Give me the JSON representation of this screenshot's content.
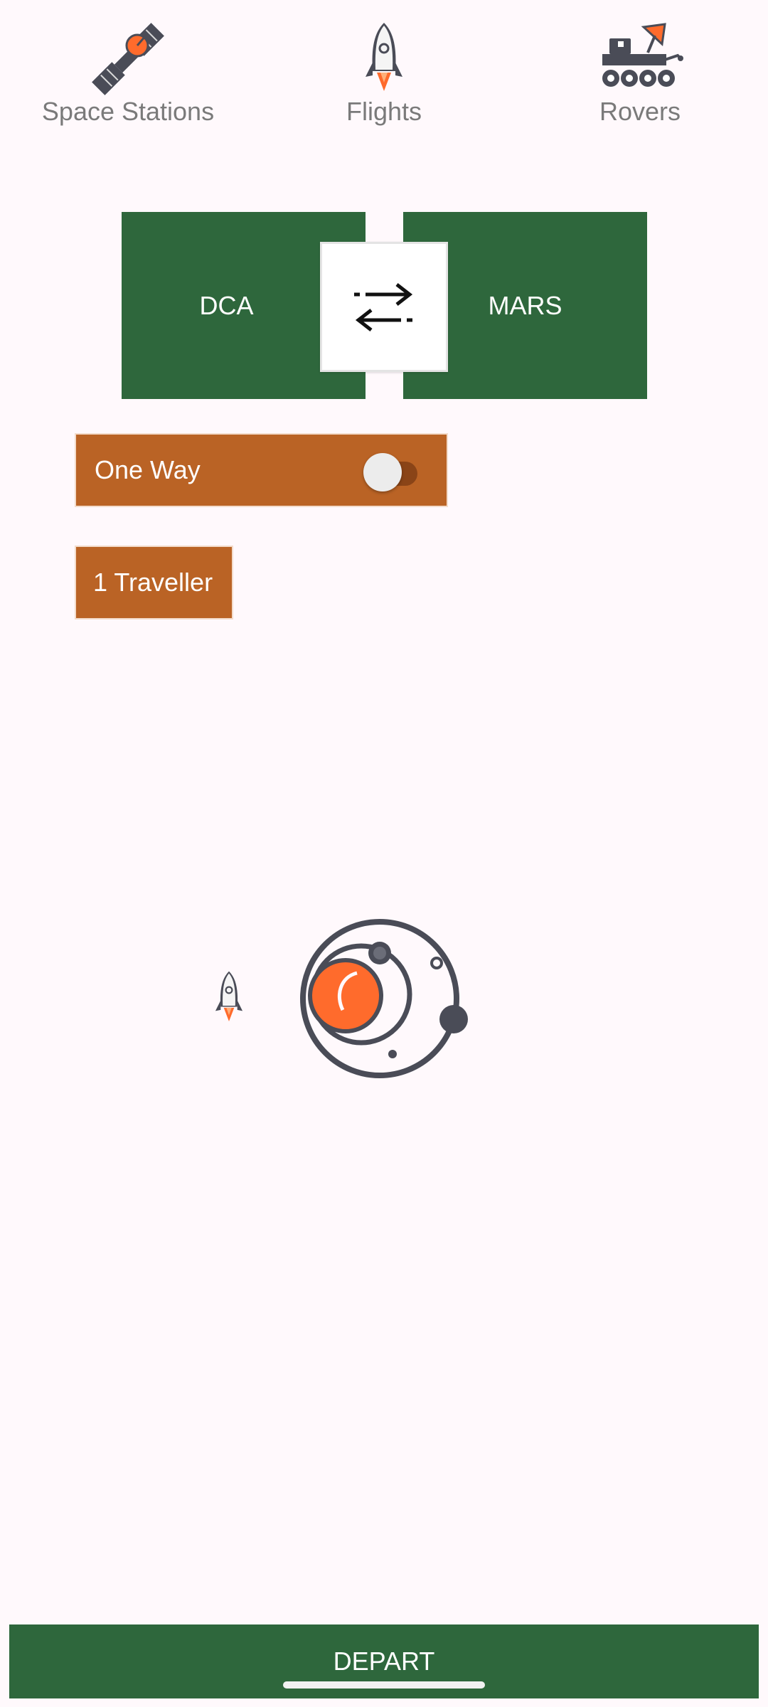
{
  "nav": {
    "items": [
      {
        "label": "Space Stations",
        "icon": "satellite-icon"
      },
      {
        "label": "Flights",
        "icon": "rocket-icon"
      },
      {
        "label": "Rovers",
        "icon": "rover-icon"
      }
    ]
  },
  "route": {
    "origin": "DCA",
    "destination": "MARS",
    "swap_icon": "swap-arrows-icon"
  },
  "options": {
    "one_way_label": "One Way",
    "one_way_enabled": false,
    "travellers_label": "1 Traveller"
  },
  "illustration": {
    "icons": [
      "rocket-icon",
      "planet-orbit-icon"
    ]
  },
  "footer": {
    "depart_label": "DEPART"
  },
  "colors": {
    "primary_green": "#2E673C",
    "accent_orange": "#BA6325",
    "planet_orange": "#FF6B2C",
    "icon_gray": "#4A4C57",
    "background": "#FFF9FC"
  }
}
